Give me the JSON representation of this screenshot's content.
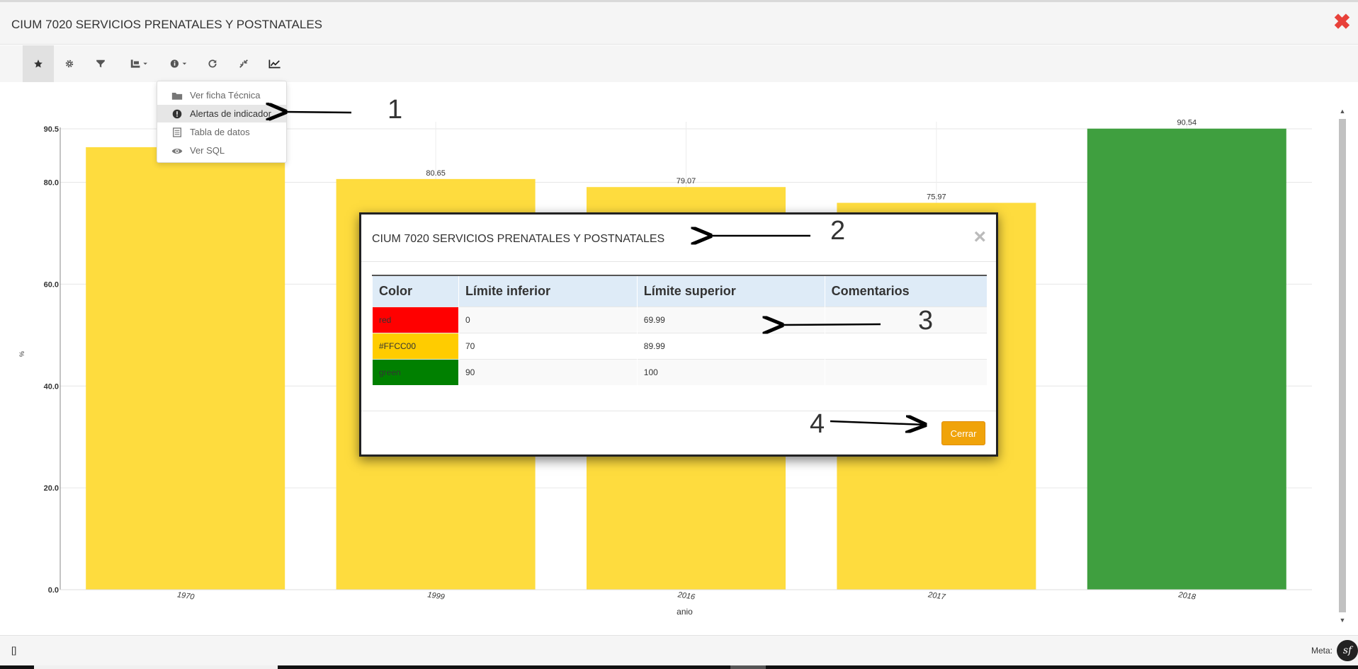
{
  "window": {
    "title": "CIUM 7020 SERVICIOS PRENATALES Y POSTNATALES",
    "close_glyph": "✖"
  },
  "toolbar": {
    "buttons": [
      {
        "name": "favorite-icon",
        "active": true
      },
      {
        "name": "gear-icon"
      },
      {
        "name": "filter-icon"
      },
      {
        "name": "chart-type-icon"
      },
      {
        "name": "info-icon"
      },
      {
        "name": "refresh-icon"
      },
      {
        "name": "compress-icon"
      },
      {
        "name": "line-chart-icon"
      }
    ]
  },
  "info_menu": {
    "items": [
      {
        "label": "Ver ficha Técnica",
        "icon": "folder-icon"
      },
      {
        "label": "Alertas de indicador",
        "icon": "exclamation-circle-icon",
        "hover": true
      },
      {
        "label": "Tabla de datos",
        "icon": "table-icon"
      },
      {
        "label": "Ver SQL",
        "icon": "eye-icon"
      }
    ]
  },
  "chart_data": {
    "type": "bar",
    "categories": [
      "1970",
      "1999",
      "2016",
      "2017",
      "2018"
    ],
    "values": [
      86.9,
      80.65,
      79.07,
      75.97,
      90.54
    ],
    "value_labels": [
      "",
      "80.65",
      "79.07",
      "75.97",
      "90.54"
    ],
    "bar_colors": [
      "#fedc3e",
      "#fedc3e",
      "#fedc3e",
      "#fedc3e",
      "#3f9f3f"
    ],
    "xlabel": "anio",
    "ylabel": "%",
    "ylim": [
      0,
      90.5
    ],
    "yticks": [
      "0.0",
      "20.0",
      "40.0",
      "60.0",
      "80.0",
      "90.5"
    ],
    "grid": true
  },
  "modal": {
    "title": "CIUM 7020 SERVICIOS PRENATALES Y POSTNATALES",
    "close_glyph": "×",
    "columns": [
      "Color",
      "Límite inferior",
      "Límite superior",
      "Comentarios"
    ],
    "rows": [
      {
        "color_label": "red",
        "swatch": "#ff0000",
        "lower": "0",
        "upper": "69.99",
        "comments": ""
      },
      {
        "color_label": "#FFCC00",
        "swatch": "#ffcc00",
        "lower": "70",
        "upper": "89.99",
        "comments": ""
      },
      {
        "color_label": "green",
        "swatch": "#008000",
        "lower": "90",
        "upper": "100",
        "comments": ""
      }
    ],
    "close_button": "Cerrar"
  },
  "footer": {
    "left_glyph": "[]",
    "meta_label": "Meta:",
    "badge": "sf"
  },
  "annotations": [
    "1",
    "2",
    "3",
    "4"
  ]
}
